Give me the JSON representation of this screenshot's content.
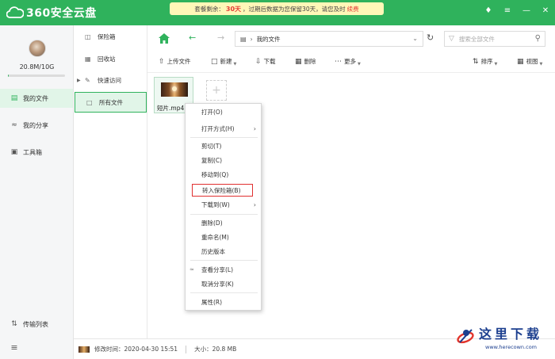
{
  "app": {
    "title": "360安全云盘"
  },
  "notice": {
    "prefix": "套餐剩余：",
    "days": "30天",
    "message": "，过期后数据为您保留30天，请您及时",
    "renew": "续费"
  },
  "window_controls": [
    "♦",
    "≡",
    "—",
    "✕"
  ],
  "sidebar": {
    "quota_text": "20.8M/10G",
    "quota_used_fraction": 0.002,
    "items": [
      {
        "label": "我的文件",
        "icon": "file-icon",
        "active": true
      },
      {
        "label": "我的分享",
        "icon": "share-icon",
        "active": false
      },
      {
        "label": "工具箱",
        "icon": "toolbox-icon",
        "active": false
      }
    ],
    "transfer_label": "传输列表"
  },
  "folders": {
    "items": [
      {
        "label": "保险箱",
        "icon": "safe-icon"
      },
      {
        "label": "回收站",
        "icon": "recycle-icon"
      },
      {
        "label": "快速访问",
        "icon": "quick-access-icon"
      },
      {
        "label": "所有文件",
        "icon": "folder-icon"
      }
    ]
  },
  "nav": {
    "path_label": "我的文件",
    "search_placeholder": "搜索全部文件"
  },
  "toolbar": {
    "upload": "上传文件",
    "new": "新建",
    "download": "下载",
    "delete": "删除",
    "more": "更多",
    "sort": "排序",
    "view": "视图"
  },
  "files": [
    {
      "name": "短片.mp4"
    }
  ],
  "context_menu": {
    "items": [
      {
        "label": "打开(O)"
      },
      {
        "label": "打开方式(H)",
        "submenu": true
      },
      {
        "label": "剪切(T)"
      },
      {
        "label": "复制(C)"
      },
      {
        "label": "移动到(Q)"
      },
      {
        "label": "转入保险箱(B)",
        "highlighted": true
      },
      {
        "label": "下载到(W)",
        "submenu": true
      },
      {
        "label": "删除(D)"
      },
      {
        "label": "重命名(M)"
      },
      {
        "label": "历史版本"
      },
      {
        "label": "查看分享(L)"
      },
      {
        "label": "取消分享(K)"
      },
      {
        "label": "属性(R)"
      }
    ]
  },
  "status": {
    "modified": "修改时间：2020-04-30 15:51",
    "size": "大小：20.8 MB"
  },
  "watermark": {
    "title": "这里下载",
    "url": "www.herecown.com"
  },
  "colors": {
    "brand": "#2fb25c",
    "active_bg": "#e1f5e8",
    "highlight_border": "#e03030"
  }
}
